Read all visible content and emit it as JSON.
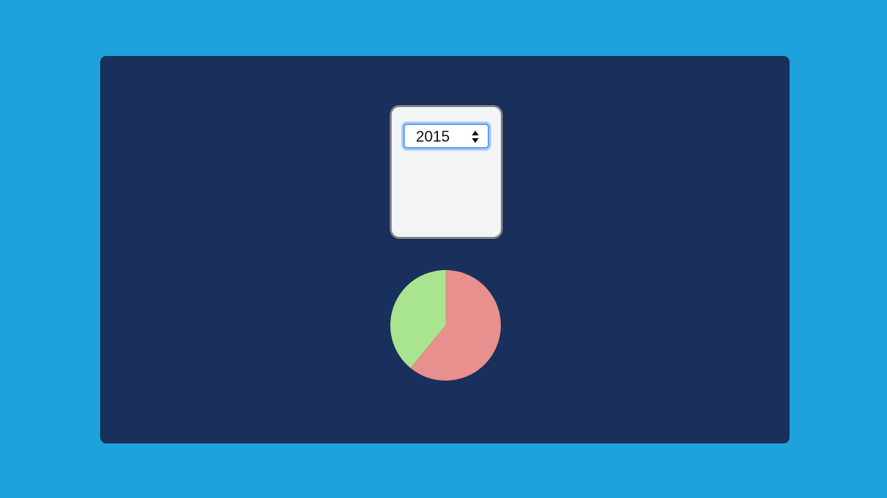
{
  "year_picker": {
    "selected": "2015",
    "stepper_icon": "up-down-arrows-icon"
  },
  "chart_data": {
    "type": "pie",
    "title": "",
    "slices": [
      {
        "value": 0.61,
        "color": "#e8908e"
      },
      {
        "value": 0.39,
        "color": "#a8e58e"
      }
    ]
  }
}
